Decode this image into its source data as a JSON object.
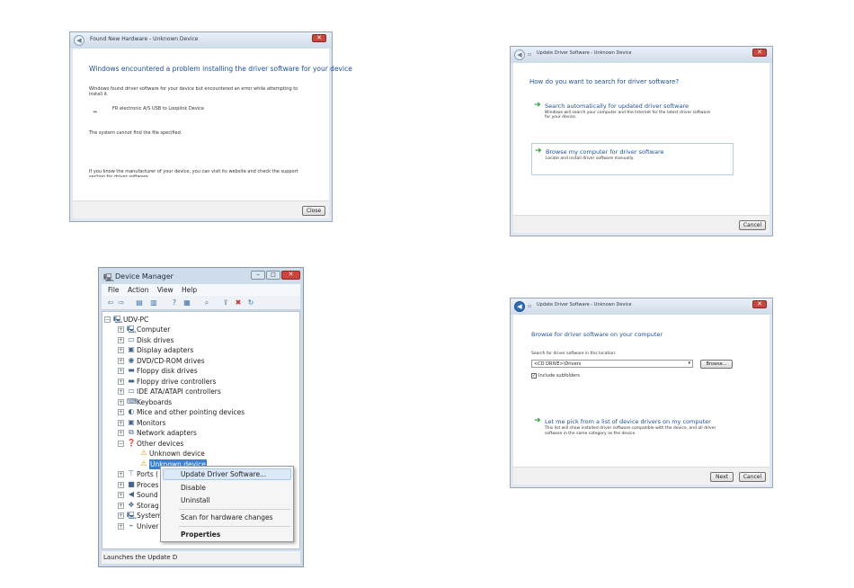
{
  "win1": {
    "title": "Found New Hardware - Unknown Device",
    "heading": "Windows encountered a problem installing the driver software for your device",
    "line1": "Windows found driver software for your device but encountered an error while attempting to",
    "line2": "install it.",
    "device": "FR electronic A/S USB to Looplink Device",
    "error": "The system cannot find the file specified.",
    "tip1": "If you know the manufacturer of your device, you can visit its website and check the support",
    "tip2": "section for driver software.",
    "close_btn": "Close"
  },
  "win2": {
    "title": "Update Driver Software - Unknown Device",
    "heading": "How do you want to search for driver software?",
    "opt1_title": "Search automatically for updated driver software",
    "opt1_desc1": "Windows will search your computer and the Internet for the latest driver software",
    "opt1_desc2": "for your device.",
    "opt2_title": "Browse my computer for driver software",
    "opt2_desc": "Locate and install driver software manually.",
    "cancel_btn": "Cancel"
  },
  "win3": {
    "title": "Update Driver Software - Unknown Device",
    "heading": "Browse for driver software on your computer",
    "search_label": "Search for driver software in this location:",
    "path_value": "<CD DRIVE>\\Drivers",
    "browse_btn": "Browse...",
    "include_subfolders": "Include subfolders",
    "pick_title": "Let me pick from a list of device drivers on my computer",
    "pick_desc1": "This list will show installed driver software compatible with the device, and all driver",
    "pick_desc2": "software in the same category as the device.",
    "next_btn": "Next",
    "cancel_btn": "Cancel"
  },
  "devmgr": {
    "title": "Device Manager",
    "menu": [
      "File",
      "Action",
      "View",
      "Help"
    ],
    "root": "UDV-PC",
    "items": [
      "Computer",
      "Disk drives",
      "Display adapters",
      "DVD/CD-ROM drives",
      "Floppy disk drives",
      "Floppy drive controllers",
      "IDE ATA/ATAPI controllers",
      "Keyboards",
      "Mice and other pointing devices",
      "Monitors",
      "Network adapters",
      "Other devices",
      "Unknown device",
      "Unknown device",
      "Ports (",
      "Proces",
      "Sound",
      "Storag",
      "System",
      "Univer"
    ],
    "status": "Launches the Update D"
  },
  "context_menu": [
    "Update Driver Software...",
    "Disable",
    "Uninstall",
    "Scan for hardware changes",
    "Properties"
  ]
}
